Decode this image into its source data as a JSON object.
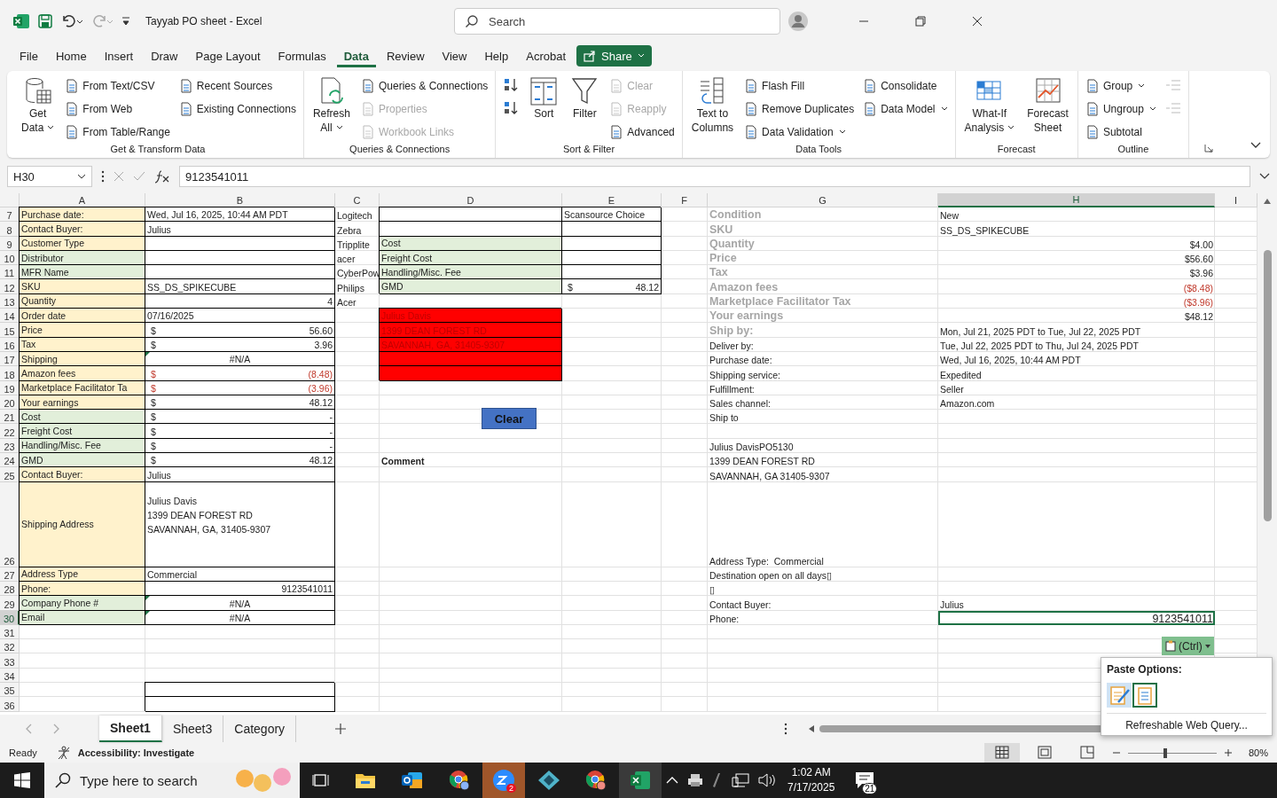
{
  "app": {
    "title": "Tayyab PO sheet - Excel",
    "search_placeholder": "Search"
  },
  "menu_tabs": [
    {
      "label": "File",
      "selected": false
    },
    {
      "label": "Home",
      "selected": false
    },
    {
      "label": "Insert",
      "selected": false
    },
    {
      "label": "Draw",
      "selected": false
    },
    {
      "label": "Page Layout",
      "selected": false
    },
    {
      "label": "Formulas",
      "selected": false
    },
    {
      "label": "Data",
      "selected": true
    },
    {
      "label": "Review",
      "selected": false
    },
    {
      "label": "View",
      "selected": false
    },
    {
      "label": "Help",
      "selected": false
    },
    {
      "label": "Acrobat",
      "selected": false
    }
  ],
  "share": "Share",
  "ribbon": {
    "groups": [
      {
        "label": "Get & Transform Data",
        "items": [
          {
            "kind": "large",
            "lines": [
              "Get",
              "Data"
            ],
            "menu": true,
            "disabled": false
          },
          {
            "kind": "small",
            "label": "From Text/CSV",
            "menu": false,
            "disabled": false
          },
          {
            "kind": "small",
            "label": "From Web",
            "menu": false,
            "disabled": false
          },
          {
            "kind": "small",
            "label": "From Table/Range",
            "menu": false,
            "disabled": false
          },
          {
            "kind": "small",
            "label": "Recent Sources",
            "menu": false,
            "disabled": false
          },
          {
            "kind": "small",
            "label": "Existing Connections",
            "menu": false,
            "disabled": false
          }
        ]
      },
      {
        "label": "Queries & Connections",
        "items": [
          {
            "kind": "large",
            "lines": [
              "Refresh",
              "All"
            ],
            "menu": true,
            "disabled": false
          },
          {
            "kind": "small",
            "label": "Queries & Connections",
            "menu": false,
            "disabled": false
          },
          {
            "kind": "small",
            "label": "Properties",
            "menu": false,
            "disabled": true
          },
          {
            "kind": "small",
            "label": "Workbook Links",
            "menu": false,
            "disabled": true
          }
        ]
      },
      {
        "label": "Sort & Filter",
        "items": [
          {
            "kind": "arrow"
          },
          {
            "kind": "arrow"
          },
          {
            "kind": "large",
            "lines": [
              "Sort"
            ],
            "menu": false,
            "disabled": false
          },
          {
            "kind": "large",
            "lines": [
              "Filter"
            ],
            "menu": false,
            "disabled": false
          },
          {
            "kind": "small",
            "label": "Clear",
            "menu": false,
            "disabled": true
          },
          {
            "kind": "small",
            "label": "Reapply",
            "menu": false,
            "disabled": true
          },
          {
            "kind": "small",
            "label": "Advanced",
            "menu": false,
            "disabled": false
          }
        ]
      },
      {
        "label": "Data Tools",
        "items": [
          {
            "kind": "large",
            "lines": [
              "Text to",
              "Columns"
            ],
            "menu": false,
            "disabled": false
          },
          {
            "kind": "small",
            "label": "Flash Fill",
            "menu": false,
            "disabled": false
          },
          {
            "kind": "small",
            "label": "Remove Duplicates",
            "menu": false,
            "disabled": false
          },
          {
            "kind": "small",
            "label": "Data Validation",
            "menu": true,
            "disabled": false
          },
          {
            "kind": "small",
            "label": "Consolidate",
            "menu": false,
            "disabled": false
          },
          {
            "kind": "small",
            "label": "Data Model",
            "menu": true,
            "disabled": false
          }
        ]
      },
      {
        "label": "Forecast",
        "items": [
          {
            "kind": "large",
            "lines": [
              "What-If",
              "Analysis"
            ],
            "menu": true,
            "disabled": false
          },
          {
            "kind": "large",
            "lines": [
              "Forecast",
              "Sheet"
            ],
            "menu": false,
            "disabled": false
          }
        ]
      },
      {
        "label": "Outline",
        "items": [
          {
            "kind": "small",
            "label": "Group",
            "menu": true,
            "disabled": false
          },
          {
            "kind": "small",
            "label": "Ungroup",
            "menu": true,
            "disabled": false
          },
          {
            "kind": "small",
            "label": "Subtotal",
            "menu": false,
            "disabled": false
          },
          {
            "kind": "outline",
            "disabled": true
          },
          {
            "kind": "outline",
            "disabled": true
          }
        ]
      }
    ]
  },
  "formula_bar": {
    "name_box": "H30",
    "formula": "9123541011"
  },
  "columns": [
    {
      "label": "A",
      "selected": false
    },
    {
      "label": "B",
      "selected": false
    },
    {
      "label": "C",
      "selected": false
    },
    {
      "label": "D",
      "selected": false
    },
    {
      "label": "E",
      "selected": false
    },
    {
      "label": "F",
      "selected": false
    },
    {
      "label": "G",
      "selected": false
    },
    {
      "label": "H",
      "selected": true
    },
    {
      "label": "I",
      "selected": false
    }
  ],
  "rows": [
    {
      "num": "7",
      "selected": false,
      "cells": {
        "a": {
          "kind": "tan",
          "text": "Purchase date:"
        },
        "b": {
          "kind": "box",
          "text": "Wed, Jul 16, 2025, 10:44 AM PDT"
        },
        "c": {
          "kind": "text",
          "text": "Logitech"
        },
        "d": {
          "kind": "box"
        },
        "e": {
          "kind": "box",
          "text": "Scansource Choice"
        },
        "g": {
          "kind": "muted",
          "text": "Condition"
        },
        "h": {
          "kind": "text",
          "text": "New"
        }
      }
    },
    {
      "num": "8",
      "selected": false,
      "cells": {
        "a": {
          "kind": "tan",
          "text": "Contact Buyer:"
        },
        "b": {
          "kind": "box",
          "text": "Julius"
        },
        "c": {
          "kind": "text",
          "text": "Zebra"
        },
        "d": {
          "kind": "box"
        },
        "e": {
          "kind": "box"
        },
        "g": {
          "kind": "muted",
          "text": "SKU"
        },
        "h": {
          "kind": "text",
          "text": "SS_DS_SPIKECUBE"
        }
      }
    },
    {
      "num": "9",
      "selected": false,
      "cells": {
        "a": {
          "kind": "tan",
          "text": "Customer Type"
        },
        "b": {
          "kind": "box"
        },
        "c": {
          "kind": "text",
          "text": "Tripplite"
        },
        "d": {
          "kind": "green",
          "text": "Cost"
        },
        "e": {
          "kind": "box"
        },
        "g": {
          "kind": "muted",
          "text": "Quantity"
        },
        "h": {
          "kind": "right",
          "text": "$4.00"
        }
      }
    },
    {
      "num": "10",
      "selected": false,
      "cells": {
        "a": {
          "kind": "green",
          "text": "Distributor"
        },
        "b": {
          "kind": "box"
        },
        "c": {
          "kind": "text",
          "text": "acer"
        },
        "d": {
          "kind": "green",
          "text": "Freight Cost"
        },
        "e": {
          "kind": "box"
        },
        "g": {
          "kind": "muted",
          "text": "Price"
        },
        "h": {
          "kind": "right",
          "text": "$56.60"
        }
      }
    },
    {
      "num": "11",
      "selected": false,
      "cells": {
        "a": {
          "kind": "green",
          "text": "MFR Name"
        },
        "b": {
          "kind": "box"
        },
        "c": {
          "kind": "text",
          "text": "CyberPow"
        },
        "d": {
          "kind": "green",
          "text": "Handling/Misc. Fee"
        },
        "e": {
          "kind": "box"
        },
        "g": {
          "kind": "muted",
          "text": "Tax"
        },
        "h": {
          "kind": "right",
          "text": "$3.96"
        }
      }
    },
    {
      "num": "12",
      "selected": false,
      "cells": {
        "a": {
          "kind": "tan",
          "text": "SKU"
        },
        "b": {
          "kind": "box",
          "text": "SS_DS_SPIKECUBE"
        },
        "c": {
          "kind": "text",
          "text": "Philips"
        },
        "d": {
          "kind": "green",
          "text": "GMD"
        },
        "e": {
          "kind": "money",
          "symbol": "$",
          "text": "48.12"
        },
        "g": {
          "kind": "muted",
          "text": "Amazon fees"
        },
        "h": {
          "kind": "rightneg",
          "text": "($8.48)"
        }
      }
    },
    {
      "num": "13",
      "selected": false,
      "cells": {
        "a": {
          "kind": "tan",
          "text": "Quantity"
        },
        "b": {
          "kind": "boxright",
          "text": "4"
        },
        "c": {
          "kind": "text",
          "text": "Acer"
        },
        "g": {
          "kind": "muted",
          "text": "Marketplace Facilitator Tax"
        },
        "h": {
          "kind": "rightneg",
          "text": "($3.96)"
        }
      }
    },
    {
      "num": "14",
      "selected": false,
      "cells": {
        "a": {
          "kind": "tan",
          "text": "Order date"
        },
        "b": {
          "kind": "box",
          "text": "07/16/2025"
        },
        "d": {
          "kind": "red",
          "text": "Julius Davis"
        },
        "g": {
          "kind": "muted",
          "text": "Your earnings"
        },
        "h": {
          "kind": "right",
          "text": "$48.12"
        }
      }
    },
    {
      "num": "15",
      "selected": false,
      "cells": {
        "a": {
          "kind": "tan",
          "text": "Price"
        },
        "b": {
          "kind": "money",
          "symbol": "$",
          "text": "56.60"
        },
        "d": {
          "kind": "red",
          "text": "1399 DEAN FOREST RD"
        },
        "g": {
          "kind": "muted",
          "text": "Ship by:"
        },
        "h": {
          "kind": "text",
          "text": "Mon, Jul 21, 2025 PDT to Tue, Jul 22, 2025 PDT"
        }
      }
    },
    {
      "num": "16",
      "selected": false,
      "cells": {
        "a": {
          "kind": "tan",
          "text": "Tax"
        },
        "b": {
          "kind": "money",
          "symbol": "$",
          "text": "3.96"
        },
        "d": {
          "kind": "red",
          "text": "SAVANNAH, GA, 31405-9307"
        },
        "g": {
          "kind": "text",
          "text": "Deliver by:"
        },
        "h": {
          "kind": "text",
          "text": "Tue, Jul 22, 2025 PDT to Thu, Jul 24, 2025 PDT"
        }
      }
    },
    {
      "num": "17",
      "selected": false,
      "cells": {
        "a": {
          "kind": "tan",
          "text": "Shipping"
        },
        "b": {
          "kind": "flagged",
          "text": "#N/A"
        },
        "d": {
          "kind": "red"
        },
        "g": {
          "kind": "text",
          "text": "Purchase date:"
        },
        "h": {
          "kind": "text",
          "text": "Wed, Jul 16, 2025, 10:44 AM PDT"
        }
      }
    },
    {
      "num": "18",
      "selected": false,
      "cells": {
        "a": {
          "kind": "tan",
          "text": "Amazon fees"
        },
        "b": {
          "kind": "moneyneg",
          "symbol": "$",
          "text": "(8.48)"
        },
        "d": {
          "kind": "red"
        },
        "g": {
          "kind": "text",
          "text": "Shipping service:"
        },
        "h": {
          "kind": "text",
          "text": "Expedited"
        }
      }
    },
    {
      "num": "19",
      "selected": false,
      "cells": {
        "a": {
          "kind": "tan",
          "text": "Marketplace Facilitator Ta"
        },
        "b": {
          "kind": "moneyneg",
          "symbol": "$",
          "text": "(3.96)"
        },
        "g": {
          "kind": "text",
          "text": "Fulfillment:"
        },
        "h": {
          "kind": "text",
          "text": "Seller"
        }
      }
    },
    {
      "num": "20",
      "selected": false,
      "cells": {
        "a": {
          "kind": "tan",
          "text": "Your earnings"
        },
        "b": {
          "kind": "money",
          "symbol": "$",
          "text": "48.12"
        },
        "g": {
          "kind": "text",
          "text": "Sales channel:"
        },
        "h": {
          "kind": "text",
          "text": "Amazon.com"
        }
      }
    },
    {
      "num": "21",
      "selected": false,
      "cells": {
        "a": {
          "kind": "green",
          "text": "Cost"
        },
        "b": {
          "kind": "money",
          "symbol": "$",
          "text": "-"
        },
        "g": {
          "kind": "text",
          "text": "Ship to"
        }
      }
    },
    {
      "num": "22",
      "selected": false,
      "cells": {
        "a": {
          "kind": "green",
          "text": "Freight Cost"
        },
        "b": {
          "kind": "money",
          "symbol": "$",
          "text": "-"
        }
      }
    },
    {
      "num": "23",
      "selected": false,
      "cells": {
        "a": {
          "kind": "green",
          "text": "Handling/Misc. Fee"
        },
        "b": {
          "kind": "money",
          "symbol": "$",
          "text": "-"
        },
        "g": {
          "kind": "text",
          "text": "Julius DavisPO5130"
        }
      }
    },
    {
      "num": "24",
      "selected": false,
      "cells": {
        "a": {
          "kind": "green",
          "text": "GMD"
        },
        "b": {
          "kind": "money",
          "symbol": "$",
          "text": "48.12"
        },
        "d": {
          "kind": "bold",
          "text": "Comment"
        },
        "g": {
          "kind": "text",
          "text": "1399 DEAN FOREST RD"
        }
      }
    },
    {
      "num": "25",
      "selected": false,
      "cells": {
        "a": {
          "kind": "tan",
          "text": "Contact Buyer:"
        },
        "b": {
          "kind": "box",
          "text": "Julius"
        },
        "g": {
          "kind": "text",
          "text": "SAVANNAH, GA 31405-9307"
        }
      }
    },
    {
      "num": "26",
      "selected": false,
      "cells": {
        "a": {
          "kind": "tan",
          "text": "Shipping Address"
        },
        "b": {
          "kind": "multiline",
          "lines": [
            "Julius Davis",
            "1399 DEAN FOREST RD",
            "SAVANNAH, GA, 31405-9307"
          ]
        },
        "g": {
          "kind": "text",
          "text": "Address Type:  Commercial"
        }
      }
    },
    {
      "num": "27",
      "selected": false,
      "cells": {
        "a": {
          "kind": "tan",
          "text": "Address Type"
        },
        "b": {
          "kind": "box",
          "text": "Commercial"
        },
        "g": {
          "kind": "text",
          "text": "Destination open on all days▯"
        }
      }
    },
    {
      "num": "28",
      "selected": false,
      "cells": {
        "a": {
          "kind": "tan",
          "text": "Phone:"
        },
        "b": {
          "kind": "boxright",
          "text": "9123541011"
        },
        "g": {
          "kind": "text",
          "text": "▯"
        }
      }
    },
    {
      "num": "29",
      "selected": false,
      "cells": {
        "a": {
          "kind": "green",
          "text": "Company Phone #"
        },
        "b": {
          "kind": "flagged",
          "text": "#N/A"
        },
        "g": {
          "kind": "text",
          "text": "Contact Buyer:"
        },
        "h": {
          "kind": "text",
          "text": "Julius"
        }
      }
    },
    {
      "num": "30",
      "selected": true,
      "cells": {
        "a": {
          "kind": "green",
          "text": "Email"
        },
        "b": {
          "kind": "flagged",
          "text": "#N/A"
        },
        "g": {
          "kind": "text",
          "text": "Phone:"
        },
        "h": {
          "kind": "rightbig",
          "text": "9123541011"
        }
      }
    },
    {
      "num": "31",
      "selected": false,
      "cells": {}
    },
    {
      "num": "32",
      "selected": false,
      "cells": {}
    },
    {
      "num": "33",
      "selected": false,
      "cells": {}
    },
    {
      "num": "34",
      "selected": false,
      "cells": {}
    },
    {
      "num": "35",
      "selected": false,
      "cells": {
        "b": {
          "kind": "box"
        }
      }
    },
    {
      "num": "36",
      "selected": false,
      "cells": {
        "b": {
          "kind": "box"
        }
      }
    }
  ],
  "clear_button": "Clear",
  "paste": {
    "button": "(Ctrl)",
    "title": "Paste Options:",
    "link": "Refreshable Web Query..."
  },
  "sheet_tabs": [
    {
      "label": "Sheet1",
      "selected": true
    },
    {
      "label": "Sheet3",
      "selected": false
    },
    {
      "label": "Category",
      "selected": false
    }
  ],
  "status": {
    "mode": "Ready",
    "accessibility": "Accessibility: Investigate",
    "zoom": "80%"
  },
  "zoom_slider": {
    "level": 0.42
  },
  "taskbar": {
    "search_placeholder": "Type here to search",
    "chat_badge": "2",
    "time": "1:02 AM",
    "date": "7/17/2025",
    "notifications": "21"
  }
}
